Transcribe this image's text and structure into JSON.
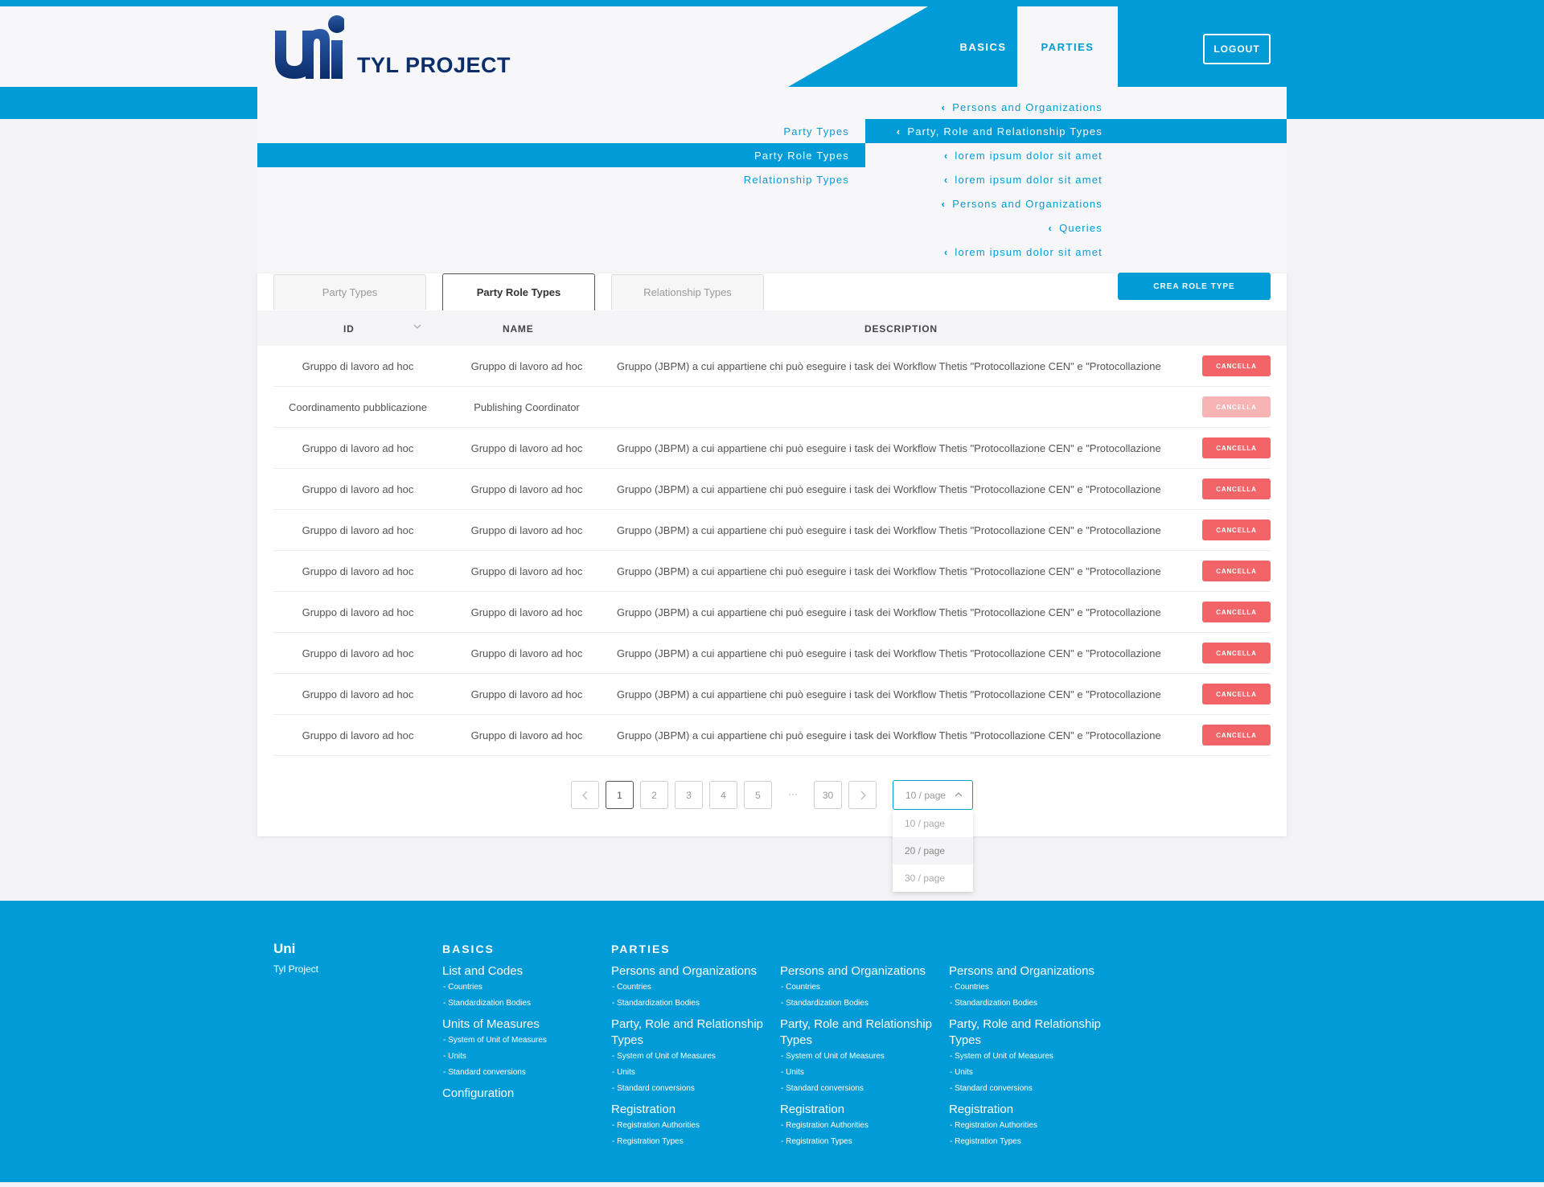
{
  "header": {
    "brand": "TYL PROJECT",
    "nav": [
      "BASICS",
      "PARTIES"
    ],
    "logout": "LOGOUT"
  },
  "menu": {
    "left": [
      "Party Types",
      "Party Role Types",
      "Relationship Types"
    ],
    "right": [
      "Persons and Organizations",
      "Party, Role and Relationship Types",
      "lorem ipsum dolor sit amet",
      "lorem ipsum dolor sit amet",
      "Persons and Organizations",
      "Queries",
      "lorem ipsum dolor sit amet"
    ]
  },
  "tabs": [
    "Party Types",
    "Party Role Types",
    "Relationship Types"
  ],
  "create_button": "CREA ROLE TYPE",
  "table": {
    "headers": [
      "ID",
      "NAME",
      "DESCRIPTION"
    ],
    "delete_label": "CANCELLA",
    "rows": [
      {
        "id": "Gruppo di lavoro ad hoc",
        "name": "Gruppo di lavoro ad hoc",
        "desc": "Gruppo (JBPM) a cui appartiene chi può eseguire i task dei Workflow Thetis \"Protocollazione CEN\" e \"Protocollazione"
      },
      {
        "id": "Coordinamento pubblicazione",
        "name": "Publishing Coordinator",
        "desc": ""
      },
      {
        "id": "Gruppo di lavoro ad hoc",
        "name": "Gruppo di lavoro ad hoc",
        "desc": "Gruppo (JBPM) a cui appartiene chi può eseguire i task dei Workflow Thetis \"Protocollazione CEN\" e \"Protocollazione"
      },
      {
        "id": "Gruppo di lavoro ad hoc",
        "name": "Gruppo di lavoro ad hoc",
        "desc": "Gruppo (JBPM) a cui appartiene chi può eseguire i task dei Workflow Thetis \"Protocollazione CEN\" e \"Protocollazione"
      },
      {
        "id": "Gruppo di lavoro ad hoc",
        "name": "Gruppo di lavoro ad hoc",
        "desc": "Gruppo (JBPM) a cui appartiene chi può eseguire i task dei Workflow Thetis \"Protocollazione CEN\" e \"Protocollazione"
      },
      {
        "id": "Gruppo di lavoro ad hoc",
        "name": "Gruppo di lavoro ad hoc",
        "desc": "Gruppo (JBPM) a cui appartiene chi può eseguire i task dei Workflow Thetis \"Protocollazione CEN\" e \"Protocollazione"
      },
      {
        "id": "Gruppo di lavoro ad hoc",
        "name": "Gruppo di lavoro ad hoc",
        "desc": "Gruppo (JBPM) a cui appartiene chi può eseguire i task dei Workflow Thetis \"Protocollazione CEN\" e \"Protocollazione"
      },
      {
        "id": "Gruppo di lavoro ad hoc",
        "name": "Gruppo di lavoro ad hoc",
        "desc": "Gruppo (JBPM) a cui appartiene chi può eseguire i task dei Workflow Thetis \"Protocollazione CEN\" e \"Protocollazione"
      },
      {
        "id": "Gruppo di lavoro ad hoc",
        "name": "Gruppo di lavoro ad hoc",
        "desc": "Gruppo (JBPM) a cui appartiene chi può eseguire i task dei Workflow Thetis \"Protocollazione CEN\" e \"Protocollazione"
      },
      {
        "id": "Gruppo di lavoro ad hoc",
        "name": "Gruppo di lavoro ad hoc",
        "desc": "Gruppo (JBPM) a cui appartiene chi può eseguire i task dei Workflow Thetis \"Protocollazione CEN\" e \"Protocollazione"
      }
    ]
  },
  "pagination": {
    "pages": [
      "1",
      "2",
      "3",
      "4",
      "5"
    ],
    "ellipsis": "···",
    "last": "30",
    "page_size": "10 / page",
    "options": [
      "10 / page",
      "20 / page",
      "30 / page"
    ]
  },
  "footer": {
    "brand": "Uni",
    "brand_sub": "Tyl Project",
    "basics_head": "BASICS",
    "parties_head": "PARTIES",
    "basics": [
      {
        "title": "List and Codes",
        "items": [
          "- Countries",
          "- Standardization Bodies"
        ]
      },
      {
        "title": "Units of Measures",
        "items": [
          "- System of Unit of Measures",
          "- Units",
          "- Standard conversions"
        ]
      },
      {
        "title": "Configuration",
        "items": []
      }
    ],
    "parties": [
      {
        "title": "Persons and Organizations",
        "items": [
          "- Countries",
          "- Standardization Bodies"
        ]
      },
      {
        "title": "Party, Role and Relationship Types",
        "items": [
          "- System of Unit of Measures",
          "- Units",
          "- Standard conversions"
        ]
      },
      {
        "title": "Registration",
        "items": [
          "- Registration Authorities",
          "- Registration Types"
        ]
      }
    ]
  },
  "colors": {
    "primary": "#019cd7",
    "danger": "#f26467",
    "brand_dark": "#0b2e6b"
  }
}
